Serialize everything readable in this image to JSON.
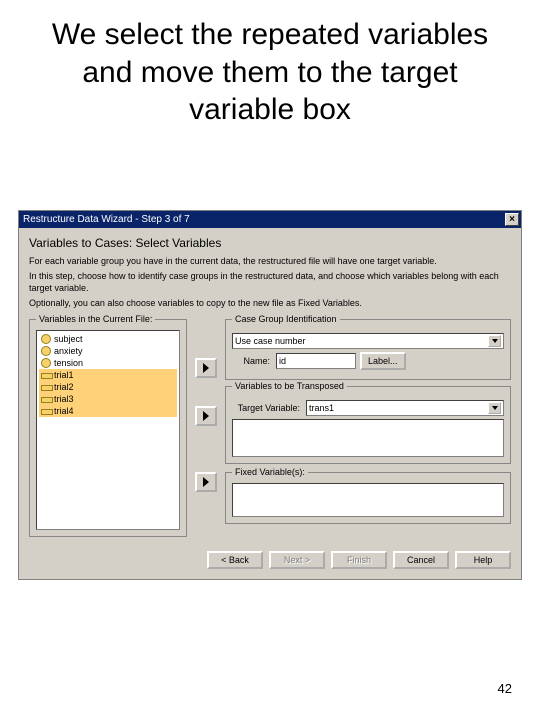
{
  "slide": {
    "title": "We select the repeated variables and move them to the target variable box",
    "page_number": "42"
  },
  "dialog": {
    "title": "Restructure Data Wizard - Step 3 of 7",
    "close_glyph": "×",
    "heading": "Variables to Cases: Select Variables",
    "intro1": "For each variable group you have in the current data, the restructured file will have one target variable.",
    "intro2": "In this step, choose how to identify case groups in the restructured data, and choose which variables belong with each target variable.",
    "intro3": "Optionally, you can also choose variables to copy to the new file as Fixed Variables.",
    "vars_group": "Variables in the Current File:",
    "variables": [
      {
        "name": "subject",
        "icon": "yellow",
        "selected": false
      },
      {
        "name": "anxiety",
        "icon": "yellow",
        "selected": false
      },
      {
        "name": "tension",
        "icon": "yellow",
        "selected": false
      },
      {
        "name": "trial1",
        "icon": "ruler",
        "selected": true
      },
      {
        "name": "trial2",
        "icon": "ruler",
        "selected": true
      },
      {
        "name": "trial3",
        "icon": "ruler",
        "selected": true
      },
      {
        "name": "trial4",
        "icon": "ruler",
        "selected": true
      }
    ],
    "case_group": {
      "title": "Case Group Identification",
      "select_value": "Use case number",
      "name_label": "Name:",
      "name_value": "id",
      "label_button": "Label..."
    },
    "target_group": {
      "title": "Variables to be Transposed",
      "target_label": "Target Variable:",
      "target_value": "trans1"
    },
    "fixed_group": {
      "title": "Fixed Variable(s):"
    },
    "buttons": {
      "back": "< Back",
      "next": "Next >",
      "finish": "Finish",
      "cancel": "Cancel",
      "help": "Help"
    }
  }
}
